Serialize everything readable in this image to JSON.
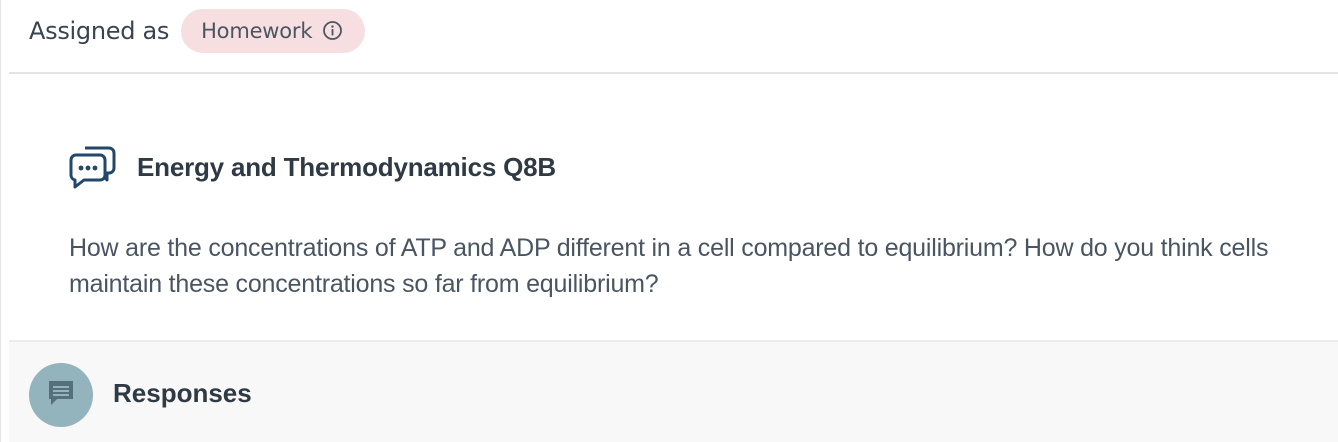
{
  "assignment": {
    "label": "Assigned as",
    "badge": "Homework",
    "badge_icon": "info-icon",
    "badge_color": "#f7dfe1"
  },
  "question": {
    "icon": "discussion-icon",
    "title": "Energy and Thermodynamics Q8B",
    "body": "How are the concentrations of ATP and ADP different in a cell compared to equilibrium? How do you think cells maintain these concentrations so far from equilibrium?"
  },
  "responses": {
    "icon": "comment-icon",
    "title": "Responses",
    "avatar_color": "#93b3bd"
  }
}
